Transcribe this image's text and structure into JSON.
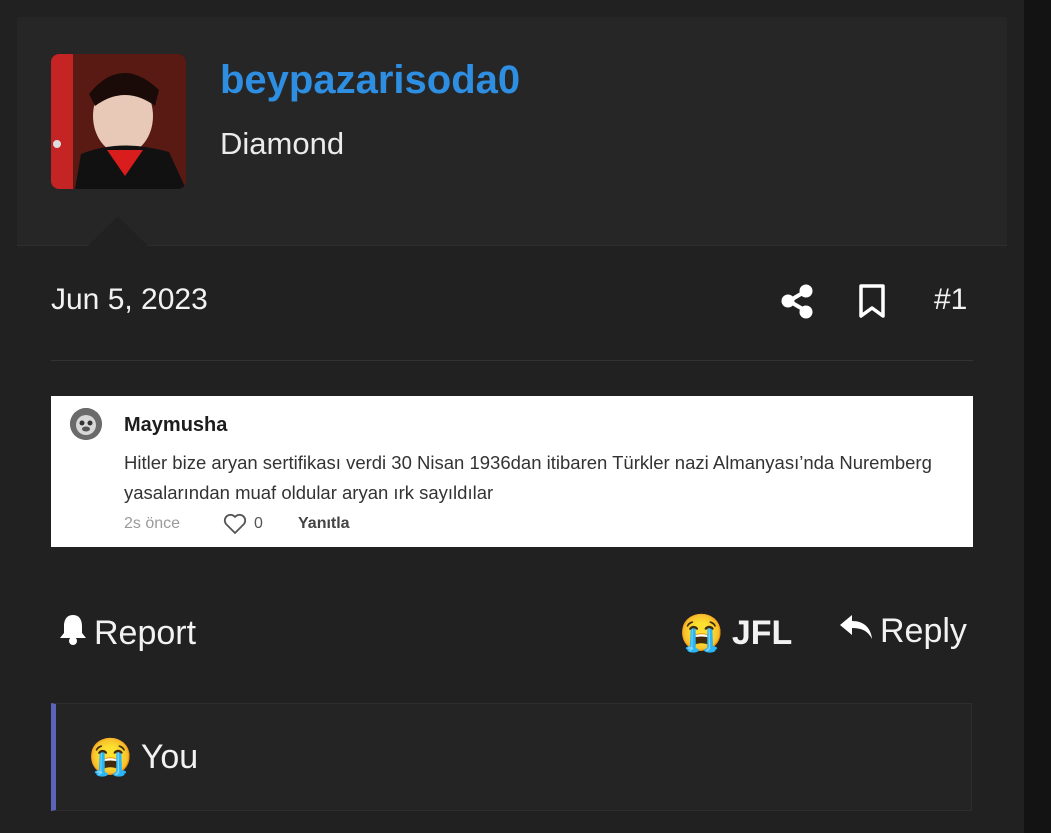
{
  "post": {
    "author": {
      "username": "beypazarisoda0",
      "title": "Diamond"
    },
    "date": "Jun 5, 2023",
    "number": "#1",
    "embedded_comment": {
      "name": "Maymusha",
      "text": "Hitler bize aryan sertifikası verdi 30 Nisan 1936dan itibaren Türkler nazi Almanyası’nda Nuremberg yasalarından muaf oldular aryan ırk sayıldılar",
      "time": "2s önce",
      "likes": "0",
      "reply_label": "Yanıtla"
    },
    "actions": {
      "report_label": "Report",
      "reaction_emoji": "😭",
      "reaction_label": "JFL",
      "reply_label": "Reply"
    },
    "quote": {
      "emoji": "😭",
      "text": "You"
    }
  },
  "colors": {
    "username": "#2d8ee2",
    "background": "#212121",
    "quote_border": "#5c64b8"
  }
}
